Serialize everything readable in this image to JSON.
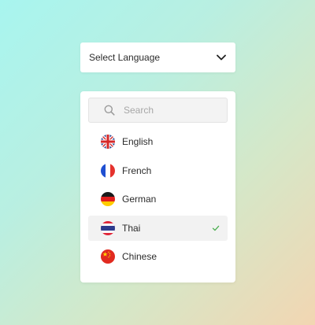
{
  "select": {
    "label": "Select Language",
    "icon": "chevron-down-icon"
  },
  "search": {
    "placeholder": "Search",
    "value": "",
    "icon": "search-icon"
  },
  "languages": [
    {
      "label": "English",
      "icon": "uk-flag-icon",
      "selected": false
    },
    {
      "label": "French",
      "icon": "france-flag-icon",
      "selected": false
    },
    {
      "label": "German",
      "icon": "germany-flag-icon",
      "selected": false
    },
    {
      "label": "Thai",
      "icon": "thailand-flag-icon",
      "selected": true
    },
    {
      "label": "Chinese",
      "icon": "china-flag-icon",
      "selected": false
    }
  ],
  "colors": {
    "check": "#4caf50",
    "selected_bg": "#f2f2f2"
  }
}
